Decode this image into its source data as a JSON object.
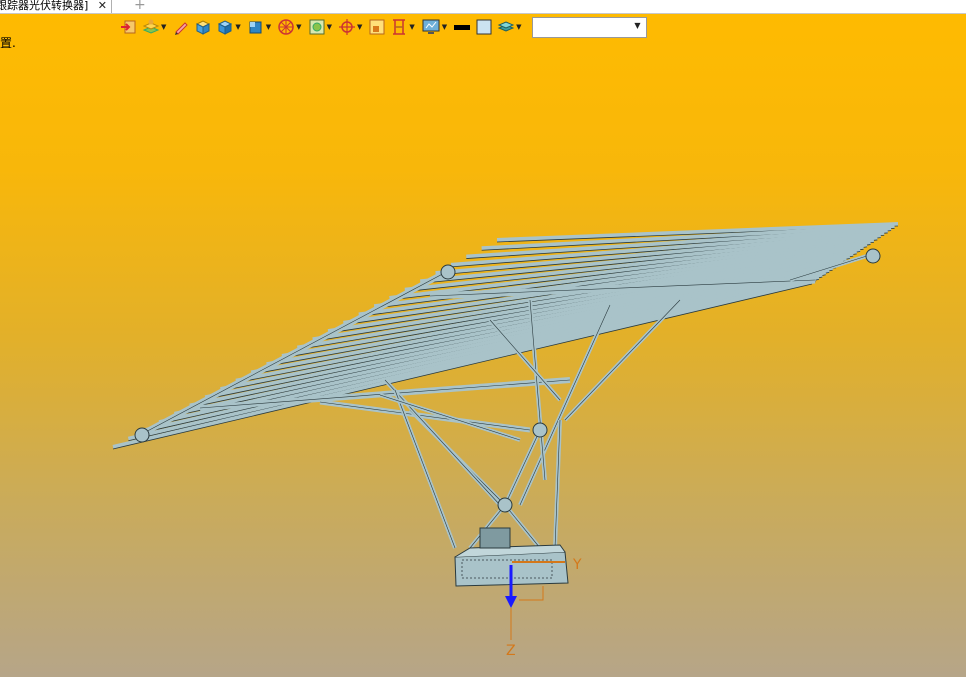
{
  "tab": {
    "title": "跟踪器光伏转换器]",
    "close": "✕",
    "new": "+"
  },
  "status_text": "置.",
  "toolbar": {
    "icons": [
      "exit-icon",
      "layer-icon",
      "pencil-icon",
      "box-icon",
      "cube-icon",
      "shaded-cube-icon",
      "wheel-icon",
      "render-icon",
      "snap-icon",
      "frame-icon",
      "bracket-icon",
      "monitor-icon",
      "black-color-swatch",
      "light-blue-color-swatch",
      "stack-icon"
    ],
    "combo_value": ""
  },
  "viewport": {
    "axis_y_label": "Y",
    "axis_z_label": "Z",
    "colors": {
      "structure": "#a9c3c9",
      "edge": "#2a3a3e",
      "axis_y": "#d4781a",
      "axis_z": "#1a1aff"
    }
  }
}
